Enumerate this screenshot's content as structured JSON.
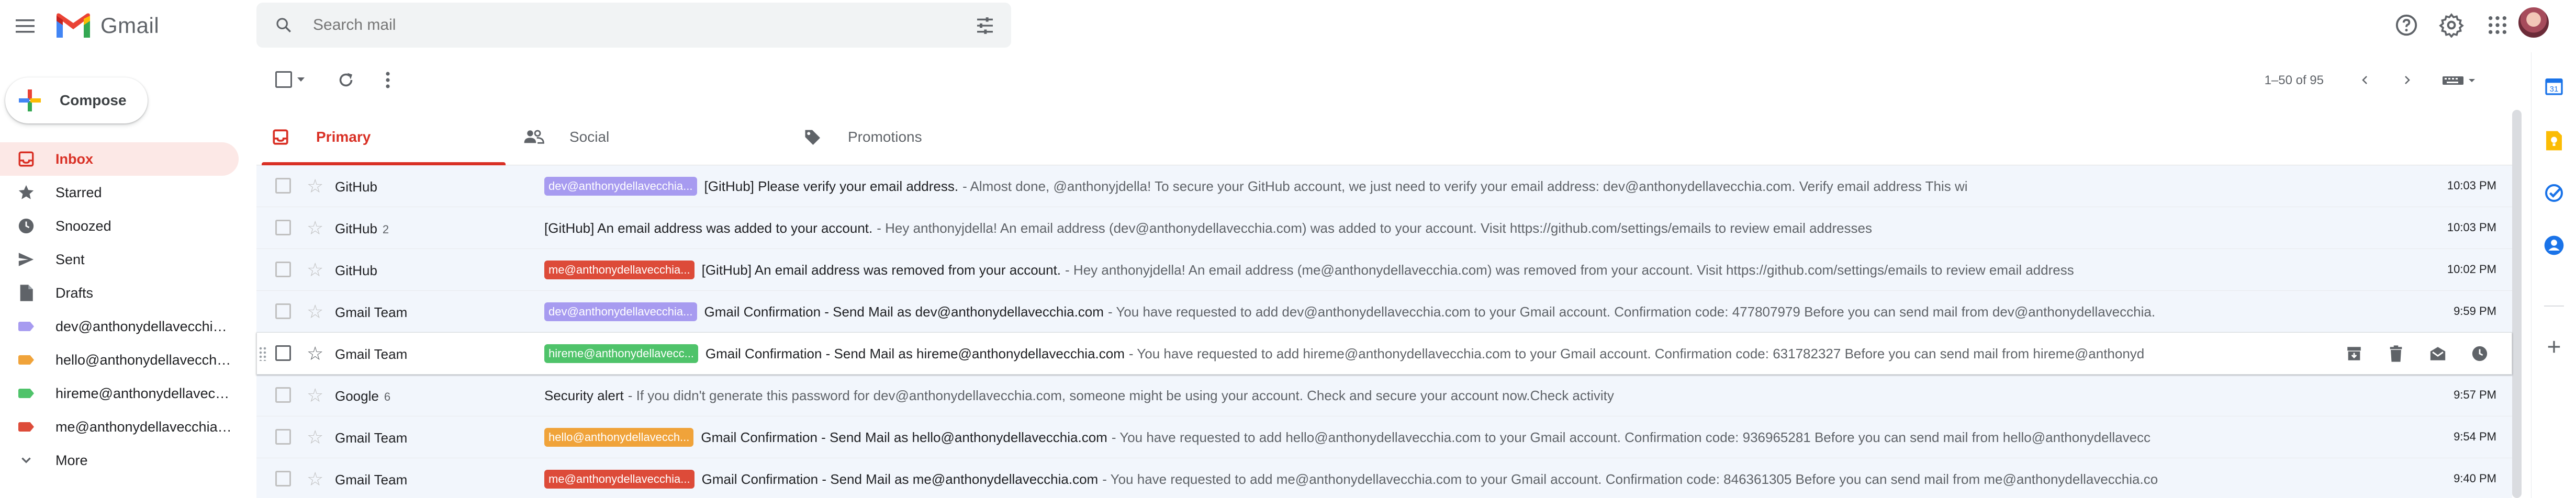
{
  "app": {
    "name": "Gmail"
  },
  "search": {
    "placeholder": "Search mail"
  },
  "compose": {
    "label": "Compose"
  },
  "sidebar": {
    "items": [
      {
        "label": "Inbox",
        "icon": "inbox-icon",
        "active": true
      },
      {
        "label": "Starred",
        "icon": "star-icon"
      },
      {
        "label": "Snoozed",
        "icon": "clock-icon"
      },
      {
        "label": "Sent",
        "icon": "send-icon"
      },
      {
        "label": "Drafts",
        "icon": "draft-icon"
      },
      {
        "label": "dev@anthonydellavecchia.com",
        "icon": "label-icon",
        "color": "#a79bf0"
      },
      {
        "label": "hello@anthonydellavecchia.com",
        "icon": "label-icon",
        "color": "#f0a33a"
      },
      {
        "label": "hireme@anthonydellavecchia.com",
        "icon": "label-icon",
        "color": "#4fc36a"
      },
      {
        "label": "me@anthonydellavecchia.com",
        "icon": "label-icon",
        "color": "#dd4b39"
      },
      {
        "label": "More",
        "icon": "chevron-down-icon"
      }
    ]
  },
  "pager": {
    "text": "1–50 of 95"
  },
  "tabs": [
    {
      "label": "Primary",
      "icon": "inbox-icon",
      "active": true
    },
    {
      "label": "Social",
      "icon": "people-icon"
    },
    {
      "label": "Promotions",
      "icon": "tag-icon"
    }
  ],
  "emails": [
    {
      "sender": "GitHub",
      "count": "",
      "label": "dev@anthonydellavecchia...",
      "label_color": "#a79bf0",
      "subject": "[GitHub] Please verify your email address.",
      "snippet": "- Almost done, @anthonyjdella! To secure your GitHub account, we just need to verify your email address: dev@anthonydellavecchia.com. Verify email address This wi",
      "time": "10:03 PM"
    },
    {
      "sender": "GitHub",
      "count": "2",
      "label": "",
      "label_color": "",
      "subject": "[GitHub] An email address was added to your account.",
      "snippet": "- Hey anthonyjdella! An email address (dev@anthonydellavecchia.com) was added to your account. Visit https://github.com/settings/emails to review email addresses",
      "time": "10:03 PM"
    },
    {
      "sender": "GitHub",
      "count": "",
      "label": "me@anthonydellavecchia...",
      "label_color": "#dd4b39",
      "subject": "[GitHub] An email address was removed from your account.",
      "snippet": "- Hey anthonyjdella! An email address (me@anthonydellavecchia.com) was removed from your account. Visit https://github.com/settings/emails to review email address",
      "time": "10:02 PM"
    },
    {
      "sender": "Gmail Team",
      "count": "",
      "label": "dev@anthonydellavecchia...",
      "label_color": "#a79bf0",
      "subject": "Gmail Confirmation - Send Mail as dev@anthonydellavecchia.com",
      "snippet": "- You have requested to add dev@anthonydellavecchia.com to your Gmail account. Confirmation code: 477807979 Before you can send mail from dev@anthonydellavecchia.",
      "time": "9:59 PM"
    },
    {
      "sender": "Gmail Team",
      "count": "",
      "label": "hireme@anthonydellavecc...",
      "label_color": "#4fc36a",
      "subject": "Gmail Confirmation - Send Mail as hireme@anthonydellavecchia.com",
      "snippet": "- You have requested to add hireme@anthonydellavecchia.com to your Gmail account. Confirmation code: 631782327 Before you can send mail from hireme@anthonyd",
      "time": "",
      "hover": true
    },
    {
      "sender": "Google",
      "count": "6",
      "label": "",
      "label_color": "",
      "subject": "Security alert",
      "snippet": "- If you didn't generate this password for dev@anthonydellavecchia.com, someone might be using your account. Check and secure your account now.Check activity",
      "time": "9:57 PM"
    },
    {
      "sender": "Gmail Team",
      "count": "",
      "label": "hello@anthonydellavecch...",
      "label_color": "#f0a33a",
      "subject": "Gmail Confirmation - Send Mail as hello@anthonydellavecchia.com",
      "snippet": "- You have requested to add hello@anthonydellavecchia.com to your Gmail account. Confirmation code: 936965281 Before you can send mail from hello@anthonydellavecc",
      "time": "9:54 PM"
    },
    {
      "sender": "Gmail Team",
      "count": "",
      "label": "me@anthonydellavecchia...",
      "label_color": "#dd4b39",
      "subject": "Gmail Confirmation - Send Mail as me@anthonydellavecchia.com",
      "snippet": "- You have requested to add me@anthonydellavecchia.com to your Gmail account. Confirmation code: 846361305 Before you can send mail from me@anthonydellavecchia.co",
      "time": "9:40 PM"
    }
  ],
  "colors": {
    "accent": "#d93025",
    "inbox_bg": "#fce8e6",
    "read_row_bg": "#f2f6fc"
  }
}
